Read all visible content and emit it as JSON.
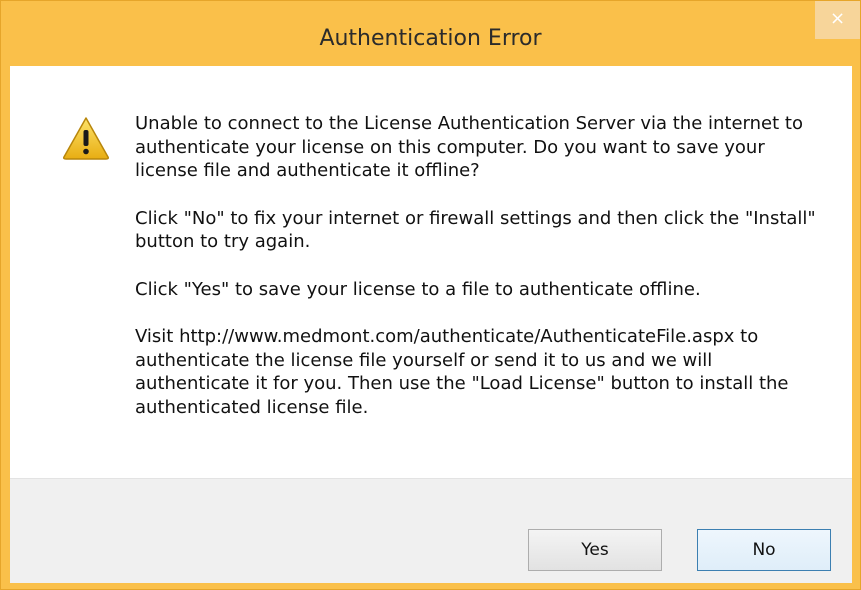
{
  "dialog": {
    "title": "Authentication Error",
    "close_glyph": "×",
    "icon": "warning-icon",
    "message": [
      "Unable to connect to the License Authentication Server via the internet to authenticate your license on this computer. Do you want to save your license file and authenticate it offline?",
      "Click \"No\" to fix your internet or firewall settings and then click the \"Install\" button to try again.",
      "Click \"Yes\" to save your license to a file to authenticate offline.",
      "Visit http://www.medmont.com/authenticate/AuthenticateFile.aspx to authenticate the license file yourself or send it to us and we will authenticate it for you.  Then use the \"Load License\" button to install the authenticated license file."
    ],
    "buttons": {
      "yes_label": "Yes",
      "no_label": "No"
    }
  },
  "colors": {
    "titlebar": "#fac04a",
    "close_button": "#f7d59a",
    "footer": "#f0f0f0",
    "warning_icon": "#f5c518"
  }
}
